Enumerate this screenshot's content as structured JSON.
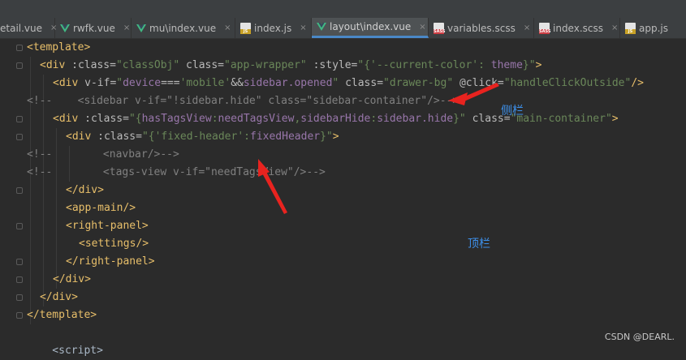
{
  "tabs": [
    {
      "label": "etail.vue",
      "icon": "vue-icon",
      "active": false
    },
    {
      "label": "rwfk.vue",
      "icon": "vue-icon",
      "active": false
    },
    {
      "label": "mu\\index.vue",
      "icon": "vue-icon",
      "active": false
    },
    {
      "label": "index.js",
      "icon": "js-file-icon",
      "active": false
    },
    {
      "label": "layout\\index.vue",
      "icon": "vue-icon",
      "active": true
    },
    {
      "label": "variables.scss",
      "icon": "sass-file-icon",
      "active": false
    },
    {
      "label": "index.scss",
      "icon": "sass-file-icon",
      "active": false
    },
    {
      "label": "app.js",
      "icon": "js-file-icon",
      "active": false
    }
  ],
  "close_glyph": "×",
  "file_badge_js": "JS",
  "file_badge_sass": "SASS",
  "code": {
    "l1": {
      "open": "<template>"
    },
    "l2": {
      "t1": "<div",
      "a1": " :class=",
      "s1": "\"classObj\"",
      "a2": " class=",
      "s2": "\"app-wrapper\"",
      "a3": " :style=",
      "s3": "\"{",
      "s4": "'--current-color'",
      "s5": ": ",
      "h1": "theme",
      "s6": "}\"",
      "t2": ">"
    },
    "l3": {
      "t1": "<div",
      "a1": " v-if=",
      "s1": "\"",
      "h1": "device",
      "s2": "===",
      "s3": "'mobile'",
      "s4": "&&",
      "h2": "sidebar.opened",
      "s5": "\"",
      "a2": " class=",
      "s6": "\"drawer-bg\"",
      "a3": " @click=",
      "s7": "\"handleClickOutside\"",
      "t2": "/>"
    },
    "l4": {
      "text": "<!--    <sidebar v-if=\"!sidebar.hide\" class=\"sidebar-container\"/>-->"
    },
    "l5": {
      "t1": "<div",
      "a1": " :class=",
      "s1": "\"{",
      "h1": "hasTagsView",
      "s2": ":",
      "h2": "needTagsView",
      "s3": ",",
      "h3": "sidebarHide",
      "s4": ":",
      "h4": "sidebar.hide",
      "s5": "}\"",
      "a2": " class=",
      "s6": "\"main-container\"",
      "t2": ">"
    },
    "l6": {
      "t1": "<div",
      "a1": " :class=",
      "s1": "\"{",
      "s2": "'fixed-header'",
      "s3": ":",
      "h1": "fixedHeader",
      "s4": "}\"",
      "t2": ">"
    },
    "l7": {
      "text": "<!--        <navbar/>-->"
    },
    "l8": {
      "text": "<!--        <tags-view v-if=\"needTagsView\"/>-->"
    },
    "l9": {
      "close": "</div>"
    },
    "l10": {
      "tag": "<app-main/>"
    },
    "l11": {
      "tag": "<right-panel>"
    },
    "l12": {
      "tag": "<settings/>"
    },
    "l13": {
      "tag": "</right-panel>"
    },
    "l14": {
      "close": "</div>"
    },
    "l15": {
      "close": "</div>"
    },
    "l16": {
      "close": "</template>"
    },
    "l17": {
      "text": "    <script>"
    }
  },
  "annotations": {
    "sidebar": "侧栏",
    "topbar": "顶栏"
  },
  "watermark": "CSDN @DEARL.",
  "colors": {
    "background": "#2b2b2b",
    "tag": "#e8bf6a",
    "string": "#6a8759",
    "variable": "#9876aa",
    "comment": "#808080",
    "arrow": "#e8231f",
    "annotation": "#3d8fe8"
  }
}
